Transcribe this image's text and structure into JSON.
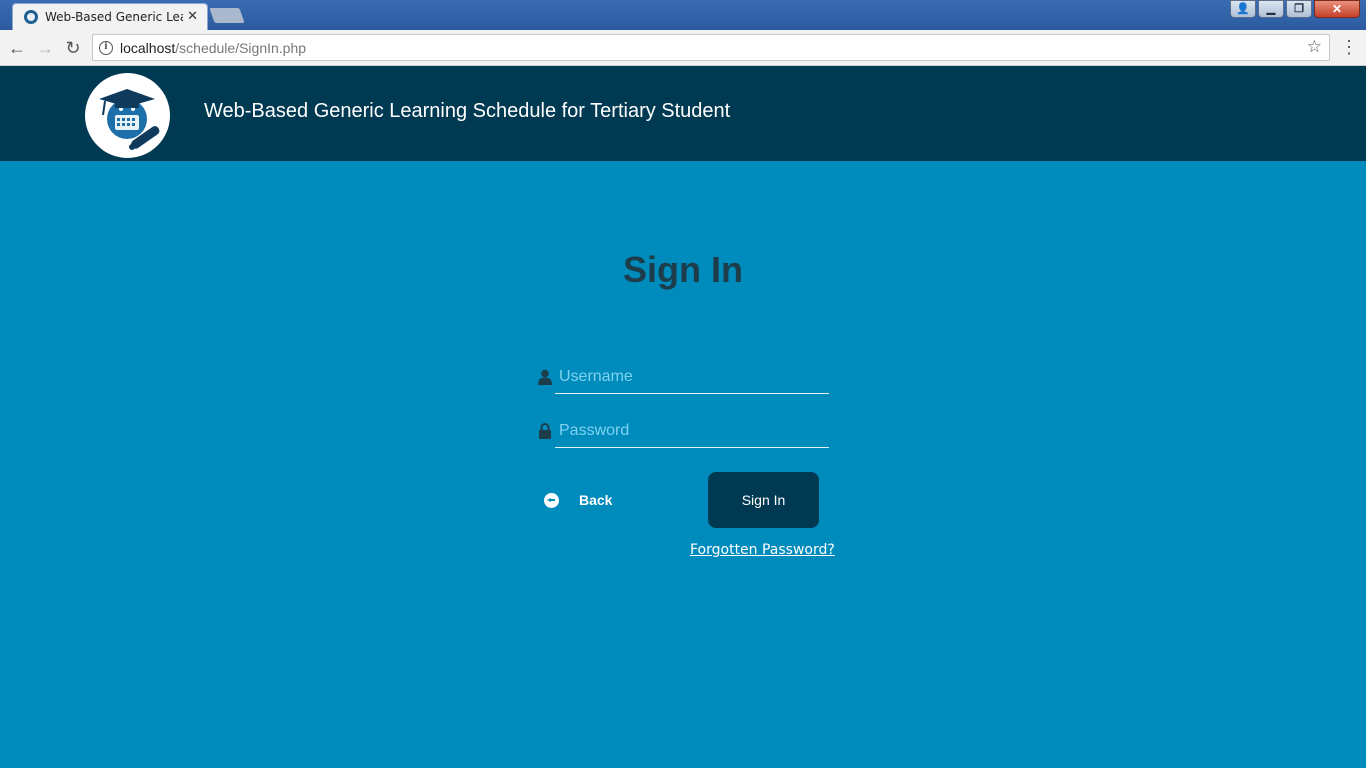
{
  "browser": {
    "tab_title": "Web-Based Generic Learning Schedule for Tertiary Student",
    "url_host": "localhost",
    "url_path": "/schedule/SignIn.php"
  },
  "header": {
    "title": "Web-Based Generic Learning Schedule for Tertiary Student"
  },
  "form": {
    "heading": "Sign In",
    "username_placeholder": "Username",
    "password_placeholder": "Password",
    "back_label": "Back",
    "signin_label": "Sign In",
    "forgot_label": "Forgotten Password?"
  },
  "colors": {
    "page_background": "#008bbd",
    "header_background": "#003a52",
    "button_background": "#003a52"
  },
  "icons": {
    "username": "user-icon",
    "password": "lock-icon",
    "back": "arrow-left-circle-icon"
  }
}
